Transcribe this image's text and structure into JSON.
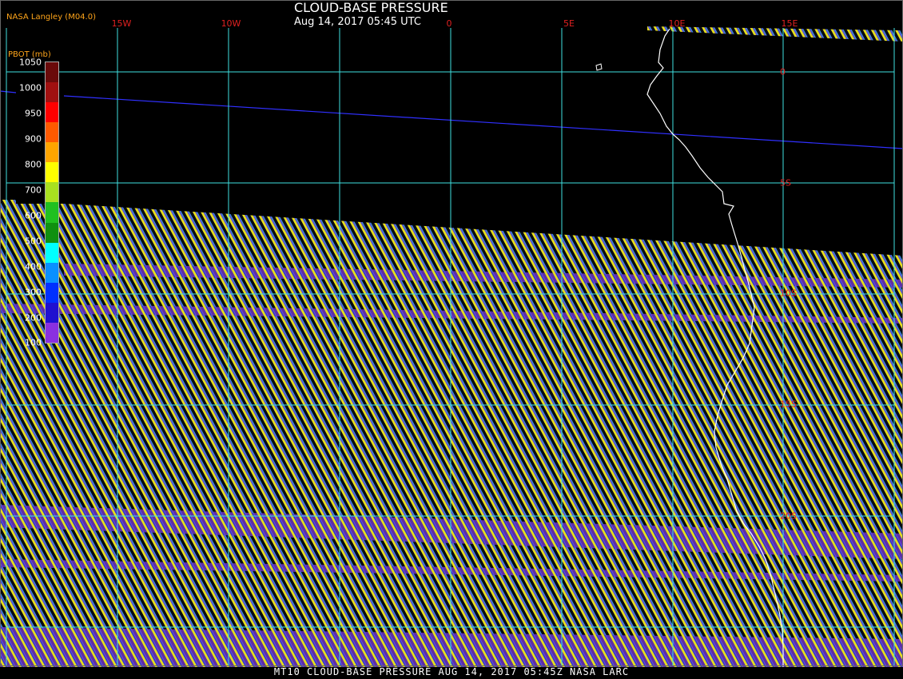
{
  "header": {
    "title": "CLOUD-BASE PRESSURE",
    "subtitle": "Aug 14, 2017 05:45 UTC",
    "credit": "NASA Langley (M04.0)"
  },
  "footer": {
    "caption": "MT10  CLOUD-BASE PRESSURE  AUG 14, 2017 05:45Z  NASA LARC"
  },
  "colorbar": {
    "title": "PBOT (mb)",
    "ticks": [
      "1050",
      "1000",
      "950",
      "900",
      "800",
      "700",
      "600",
      "500",
      "400",
      "300",
      "200",
      "100"
    ],
    "colors": [
      "#6a0a0a",
      "#a01010",
      "#ff0000",
      "#ff5a00",
      "#ffa500",
      "#ffff00",
      "#a8e020",
      "#20c020",
      "#109010",
      "#00ffff",
      "#0a90ff",
      "#0030ff",
      "#2010d0",
      "#8a30e0"
    ]
  },
  "map": {
    "lon_labels": [
      "15W",
      "10W",
      "0",
      "5E",
      "10E",
      "15E"
    ],
    "lat_labels": [
      "0",
      "5S",
      "10S",
      "15S",
      "20S"
    ],
    "coast_color": "#ffffff",
    "grid_color": "#40e0e0",
    "track_color": "#3030ff",
    "label_color": "#e02020"
  }
}
